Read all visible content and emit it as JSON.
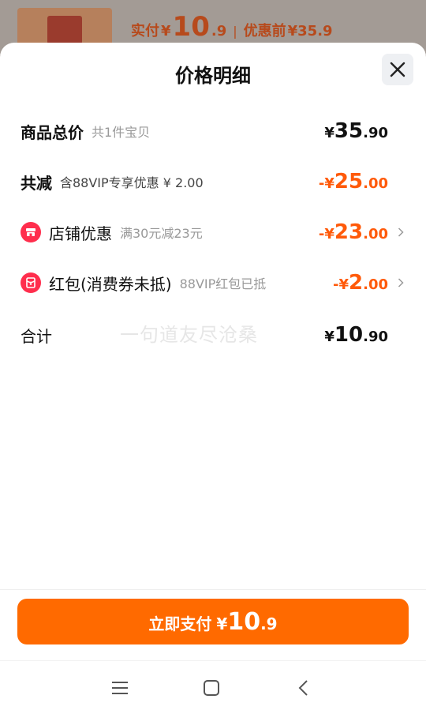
{
  "background": {
    "paid_label": "实付",
    "paid_currency": "¥",
    "paid_int": "10",
    "paid_dec": ".9",
    "separator": "|",
    "before_label": "优惠前",
    "before_value": "¥35.9"
  },
  "sheet": {
    "title": "价格明细",
    "close_icon": "close-icon"
  },
  "rows": {
    "total": {
      "label": "商品总价",
      "note": "共1件宝贝",
      "yen": "¥",
      "int": "35",
      "dec": ".90"
    },
    "reduce": {
      "label": "共减",
      "note": "含88VIP专享优惠 ¥ 2.00",
      "yen": "-¥",
      "int": "25",
      "dec": ".00"
    },
    "shop": {
      "label": "店铺优惠",
      "note": "满30元减23元",
      "yen": "-¥",
      "int": "23",
      "dec": ".00",
      "icon": "shop-icon"
    },
    "redpacket": {
      "label": "红包(消费券未抵)",
      "note": "88VIP红包已抵",
      "yen": "-¥",
      "int": "2",
      "dec": ".00",
      "icon": "red-packet-icon"
    },
    "sum": {
      "label": "合计",
      "yen": "¥",
      "int": "10",
      "dec": ".90"
    }
  },
  "watermark": "一句道友尽沧桑",
  "pay_button": {
    "label": "立即支付",
    "yen": "¥",
    "int": "10",
    "dec": ".9"
  },
  "navbar": {
    "items": [
      "menu-icon",
      "home-icon",
      "back-icon"
    ]
  },
  "colors": {
    "accent": "#ff6a00",
    "discount": "#ff5a0a",
    "badge": "#ff2e4d"
  }
}
